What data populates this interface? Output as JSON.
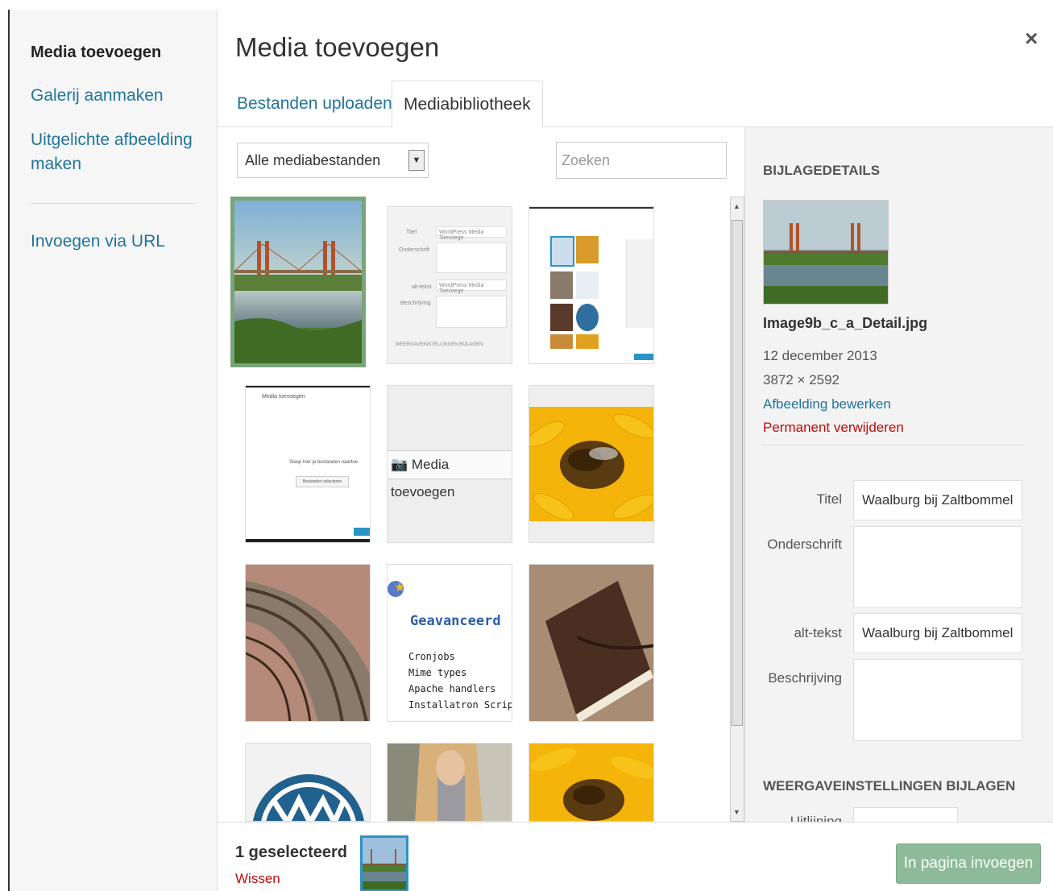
{
  "menu": {
    "active": "Media toevoegen",
    "gallery": "Galerij aanmaken",
    "featured_1": "Uitgelichte afbeelding",
    "featured_2": "maken",
    "url": "Invoegen via URL"
  },
  "title": "Media toevoegen",
  "close_glyph": "×",
  "tabs": [
    "Bestanden uploaden",
    "Mediabibliotheek"
  ],
  "toolbar": {
    "filter_value": "Alle mediabestanden",
    "search_placeholder": "Zoeken"
  },
  "thumbs": {
    "form_labels": [
      "Titel",
      "Onderschrift",
      "alt-tekst",
      "Beschrijving",
      "WEERGAVEINSTELLINGEN BIJLAGEN"
    ],
    "form_value": "WordPress Media Toevoege",
    "upload_title": "Media toevoegen",
    "upload_drop": "Sleep hier je bestanden naartoe",
    "upload_btn": "Bestanden selecteren",
    "button_label": "Media toevoegen",
    "adv_title": "Geavanceerd",
    "adv_items": [
      "Cronjobs",
      "Mime types",
      "Apache handlers",
      "Installatron Script Insta"
    ]
  },
  "sidebar": {
    "heading": "BIJLAGEDETAILS",
    "filename": "Image9b_c_a_Detail.jpg",
    "date": "12 december 2013",
    "dimensions": "3872 × 2592",
    "edit_link": "Afbeelding bewerken",
    "delete_link": "Permanent verwijderen",
    "labels": {
      "title": "Titel",
      "caption": "Onderschrift",
      "alt": "alt-tekst",
      "description": "Beschrijving"
    },
    "values": {
      "title": "Waalburg bij Zaltbommel",
      "caption": "",
      "alt": "Waalburg bij Zaltbommel",
      "description": ""
    },
    "display_heading": "WEERGAVEINSTELLINGEN BIJLAGEN",
    "align_label": "Uitlijning"
  },
  "bottom": {
    "selected": "1 geselecteerd",
    "clear": "Wissen",
    "insert": "In pagina invoegen"
  },
  "colors": {
    "link": "#21759b",
    "danger": "#bc0b0b",
    "selected_border": "#7aa47a",
    "insert_button": "#8dba99"
  }
}
